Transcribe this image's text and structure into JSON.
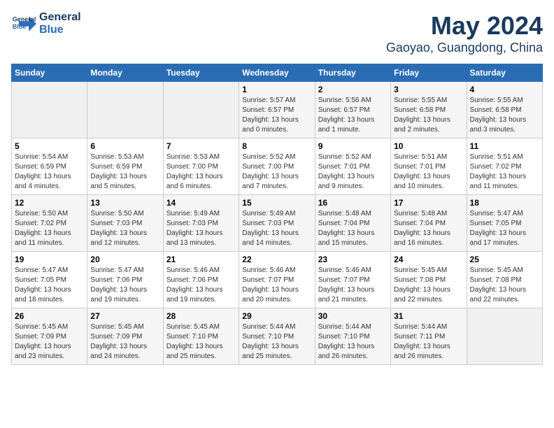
{
  "logo": {
    "line1": "General",
    "line2": "Blue"
  },
  "title": "May 2024",
  "location": "Gaoyao, Guangdong, China",
  "days_of_week": [
    "Sunday",
    "Monday",
    "Tuesday",
    "Wednesday",
    "Thursday",
    "Friday",
    "Saturday"
  ],
  "weeks": [
    [
      {
        "day": "",
        "sunrise": "",
        "sunset": "",
        "daylight": ""
      },
      {
        "day": "",
        "sunrise": "",
        "sunset": "",
        "daylight": ""
      },
      {
        "day": "",
        "sunrise": "",
        "sunset": "",
        "daylight": ""
      },
      {
        "day": "1",
        "sunrise": "Sunrise: 5:57 AM",
        "sunset": "Sunset: 6:57 PM",
        "daylight": "Daylight: 13 hours and 0 minutes."
      },
      {
        "day": "2",
        "sunrise": "Sunrise: 5:56 AM",
        "sunset": "Sunset: 6:57 PM",
        "daylight": "Daylight: 13 hours and 1 minute."
      },
      {
        "day": "3",
        "sunrise": "Sunrise: 5:55 AM",
        "sunset": "Sunset: 6:58 PM",
        "daylight": "Daylight: 13 hours and 2 minutes."
      },
      {
        "day": "4",
        "sunrise": "Sunrise: 5:55 AM",
        "sunset": "Sunset: 6:58 PM",
        "daylight": "Daylight: 13 hours and 3 minutes."
      }
    ],
    [
      {
        "day": "5",
        "sunrise": "Sunrise: 5:54 AM",
        "sunset": "Sunset: 6:59 PM",
        "daylight": "Daylight: 13 hours and 4 minutes."
      },
      {
        "day": "6",
        "sunrise": "Sunrise: 5:53 AM",
        "sunset": "Sunset: 6:59 PM",
        "daylight": "Daylight: 13 hours and 5 minutes."
      },
      {
        "day": "7",
        "sunrise": "Sunrise: 5:53 AM",
        "sunset": "Sunset: 7:00 PM",
        "daylight": "Daylight: 13 hours and 6 minutes."
      },
      {
        "day": "8",
        "sunrise": "Sunrise: 5:52 AM",
        "sunset": "Sunset: 7:00 PM",
        "daylight": "Daylight: 13 hours and 7 minutes."
      },
      {
        "day": "9",
        "sunrise": "Sunrise: 5:52 AM",
        "sunset": "Sunset: 7:01 PM",
        "daylight": "Daylight: 13 hours and 9 minutes."
      },
      {
        "day": "10",
        "sunrise": "Sunrise: 5:51 AM",
        "sunset": "Sunset: 7:01 PM",
        "daylight": "Daylight: 13 hours and 10 minutes."
      },
      {
        "day": "11",
        "sunrise": "Sunrise: 5:51 AM",
        "sunset": "Sunset: 7:02 PM",
        "daylight": "Daylight: 13 hours and 11 minutes."
      }
    ],
    [
      {
        "day": "12",
        "sunrise": "Sunrise: 5:50 AM",
        "sunset": "Sunset: 7:02 PM",
        "daylight": "Daylight: 13 hours and 11 minutes."
      },
      {
        "day": "13",
        "sunrise": "Sunrise: 5:50 AM",
        "sunset": "Sunset: 7:03 PM",
        "daylight": "Daylight: 13 hours and 12 minutes."
      },
      {
        "day": "14",
        "sunrise": "Sunrise: 5:49 AM",
        "sunset": "Sunset: 7:03 PM",
        "daylight": "Daylight: 13 hours and 13 minutes."
      },
      {
        "day": "15",
        "sunrise": "Sunrise: 5:49 AM",
        "sunset": "Sunset: 7:03 PM",
        "daylight": "Daylight: 13 hours and 14 minutes."
      },
      {
        "day": "16",
        "sunrise": "Sunrise: 5:48 AM",
        "sunset": "Sunset: 7:04 PM",
        "daylight": "Daylight: 13 hours and 15 minutes."
      },
      {
        "day": "17",
        "sunrise": "Sunrise: 5:48 AM",
        "sunset": "Sunset: 7:04 PM",
        "daylight": "Daylight: 13 hours and 16 minutes."
      },
      {
        "day": "18",
        "sunrise": "Sunrise: 5:47 AM",
        "sunset": "Sunset: 7:05 PM",
        "daylight": "Daylight: 13 hours and 17 minutes."
      }
    ],
    [
      {
        "day": "19",
        "sunrise": "Sunrise: 5:47 AM",
        "sunset": "Sunset: 7:05 PM",
        "daylight": "Daylight: 13 hours and 18 minutes."
      },
      {
        "day": "20",
        "sunrise": "Sunrise: 5:47 AM",
        "sunset": "Sunset: 7:06 PM",
        "daylight": "Daylight: 13 hours and 19 minutes."
      },
      {
        "day": "21",
        "sunrise": "Sunrise: 5:46 AM",
        "sunset": "Sunset: 7:06 PM",
        "daylight": "Daylight: 13 hours and 19 minutes."
      },
      {
        "day": "22",
        "sunrise": "Sunrise: 5:46 AM",
        "sunset": "Sunset: 7:07 PM",
        "daylight": "Daylight: 13 hours and 20 minutes."
      },
      {
        "day": "23",
        "sunrise": "Sunrise: 5:46 AM",
        "sunset": "Sunset: 7:07 PM",
        "daylight": "Daylight: 13 hours and 21 minutes."
      },
      {
        "day": "24",
        "sunrise": "Sunrise: 5:45 AM",
        "sunset": "Sunset: 7:08 PM",
        "daylight": "Daylight: 13 hours and 22 minutes."
      },
      {
        "day": "25",
        "sunrise": "Sunrise: 5:45 AM",
        "sunset": "Sunset: 7:08 PM",
        "daylight": "Daylight: 13 hours and 22 minutes."
      }
    ],
    [
      {
        "day": "26",
        "sunrise": "Sunrise: 5:45 AM",
        "sunset": "Sunset: 7:09 PM",
        "daylight": "Daylight: 13 hours and 23 minutes."
      },
      {
        "day": "27",
        "sunrise": "Sunrise: 5:45 AM",
        "sunset": "Sunset: 7:09 PM",
        "daylight": "Daylight: 13 hours and 24 minutes."
      },
      {
        "day": "28",
        "sunrise": "Sunrise: 5:45 AM",
        "sunset": "Sunset: 7:10 PM",
        "daylight": "Daylight: 13 hours and 25 minutes."
      },
      {
        "day": "29",
        "sunrise": "Sunrise: 5:44 AM",
        "sunset": "Sunset: 7:10 PM",
        "daylight": "Daylight: 13 hours and 25 minutes."
      },
      {
        "day": "30",
        "sunrise": "Sunrise: 5:44 AM",
        "sunset": "Sunset: 7:10 PM",
        "daylight": "Daylight: 13 hours and 26 minutes."
      },
      {
        "day": "31",
        "sunrise": "Sunrise: 5:44 AM",
        "sunset": "Sunset: 7:11 PM",
        "daylight": "Daylight: 13 hours and 26 minutes."
      },
      {
        "day": "",
        "sunrise": "",
        "sunset": "",
        "daylight": ""
      }
    ]
  ]
}
